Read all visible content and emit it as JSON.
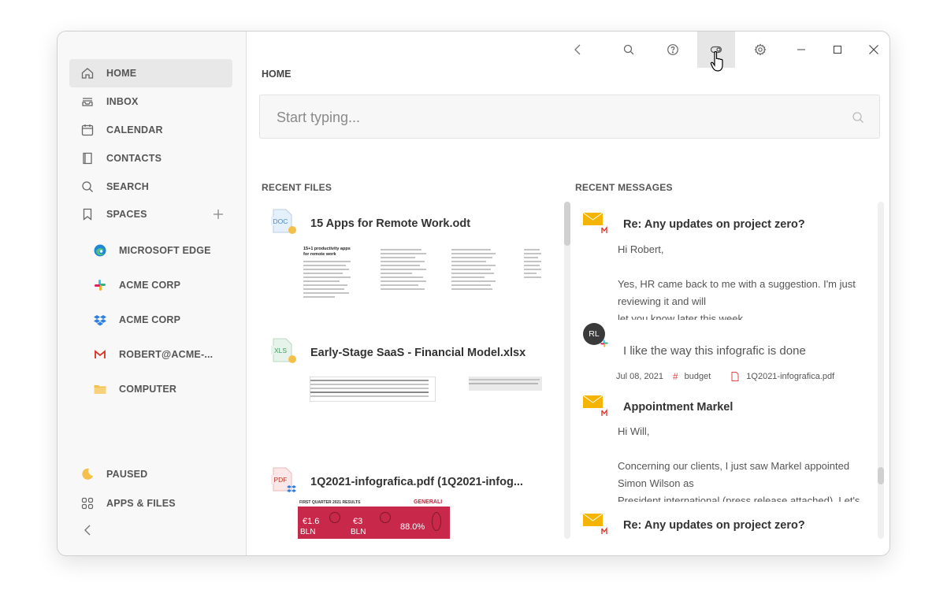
{
  "sidebar": {
    "nav": [
      {
        "label": "HOME",
        "icon": "home-icon",
        "active": true
      },
      {
        "label": "INBOX",
        "icon": "inbox-icon"
      },
      {
        "label": "CALENDAR",
        "icon": "calendar-icon"
      },
      {
        "label": "CONTACTS",
        "icon": "contacts-icon"
      },
      {
        "label": "SEARCH",
        "icon": "search-icon"
      },
      {
        "label": "SPACES",
        "icon": "bookmark-icon"
      }
    ],
    "spaces": [
      {
        "label": "MICROSOFT EDGE",
        "icon": "edge-icon"
      },
      {
        "label": "ACME CORP",
        "icon": "slack-icon"
      },
      {
        "label": "ACME CORP",
        "icon": "dropbox-icon"
      },
      {
        "label": "ROBERT@ACME-...",
        "icon": "gmail-icon"
      },
      {
        "label": "COMPUTER",
        "icon": "folder-icon"
      }
    ],
    "footer": [
      {
        "label": "PAUSED",
        "icon": "moon-icon"
      },
      {
        "label": "APPS & FILES",
        "icon": "apps-grid-icon"
      }
    ]
  },
  "main": {
    "title": "HOME",
    "search": {
      "placeholder": "Start typing..."
    },
    "recent_files_title": "RECENT FILES",
    "recent_messages_title": "RECENT MESSAGES",
    "files": [
      {
        "name": "15 Apps for Remote Work.odt",
        "badge": "DOC",
        "thumb_title": "15+1 productivity apps for remote work"
      },
      {
        "name": "Early-Stage SaaS - Financial Model.xlsx",
        "badge": "XLS"
      },
      {
        "name": "1Q2021-infografica.pdf (1Q2021-infog...",
        "badge": "PDF",
        "infographic": {
          "header_left": "FIRST QUARTER 2021 RESULTS",
          "brand": "GENERALI",
          "values": [
            "€1.6",
            "€3",
            "88.0%"
          ],
          "unit": "BLN"
        }
      }
    ],
    "messages": [
      {
        "type": "mail",
        "subject": "Re: Any updates on project zero?",
        "lines": [
          "Hi Robert,",
          "",
          "Yes, HR came back to me with a suggestion. I'm just reviewing it and will",
          "let you know later this week."
        ]
      },
      {
        "type": "chat",
        "avatar": "RL",
        "text": "I like the way this infografic is done",
        "date": "Jul 08, 2021",
        "tag": "budget",
        "attachment": "1Q2021-infografica.pdf"
      },
      {
        "type": "mail",
        "subject": "Appointment Markel",
        "lines": [
          "Hi Will,",
          "",
          "Concerning our clients, I just saw Markel appointed Simon Wilson as",
          "President international (press release attached). Let's"
        ]
      },
      {
        "type": "mail",
        "subject": "Re: Any updates on project zero?"
      }
    ]
  },
  "colors": {
    "accent": "#f5b400",
    "brand_red": "#c0243a",
    "gmail_red": "#d93025"
  }
}
